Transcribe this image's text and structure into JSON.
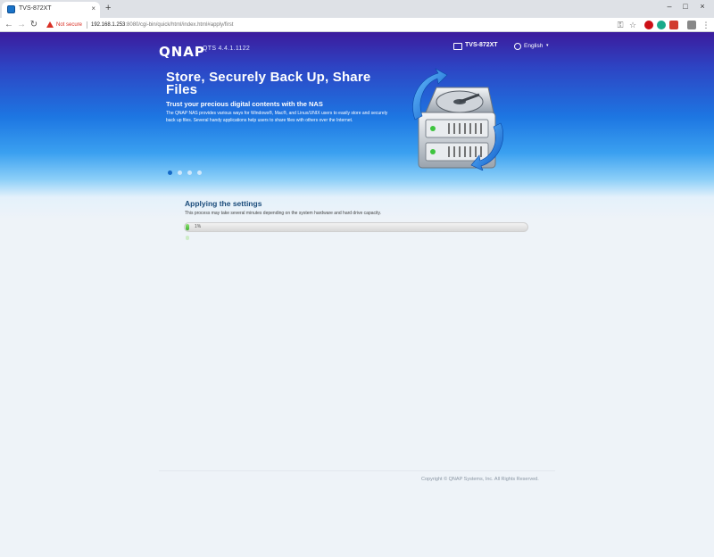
{
  "browser": {
    "tab_title": "TVS-872XT",
    "tab_close": "×",
    "new_tab": "+",
    "window_controls": {
      "minimize": "–",
      "maximize": "□",
      "close": "×"
    },
    "nav": {
      "back": "←",
      "forward": "→",
      "reload": "↻"
    },
    "address": {
      "security_label": "Not secure",
      "host": "192.168.1.253",
      "path": ":8080/cgi-bin/quick/html/index.html#apply/first"
    }
  },
  "header": {
    "logo": "QNAP",
    "qts_version": "QTS 4.4.1.1122",
    "device_name": "TVS-872XT",
    "language": "English",
    "language_caret": "▾"
  },
  "hero": {
    "title": "Store, Securely Back Up, Share Files",
    "subtitle": "Trust your precious digital contents with the NAS",
    "description": "The QNAP NAS provides various ways for Windows®, Mac®, and Linux/UNIX users to easily store and securely back up files. Several handy applications help users to share files with others over the Internet.",
    "slides_total": 4,
    "active_slide": 1
  },
  "apply": {
    "title": "Applying the settings",
    "description": "This process may take several minutes depending on the system hardware and hard drive capacity.",
    "progress_percent": 1,
    "progress_label": "1%"
  },
  "footer": {
    "copyright": "Copyright © QNAP Systems, Inc. All Rights Reserved."
  },
  "colors": {
    "header_top": "#3c1b9c",
    "banner_blue": "#1d76e2",
    "progress_green": "#3db12c",
    "title_blue": "#1a4b7a",
    "warning_red": "#d93025"
  }
}
